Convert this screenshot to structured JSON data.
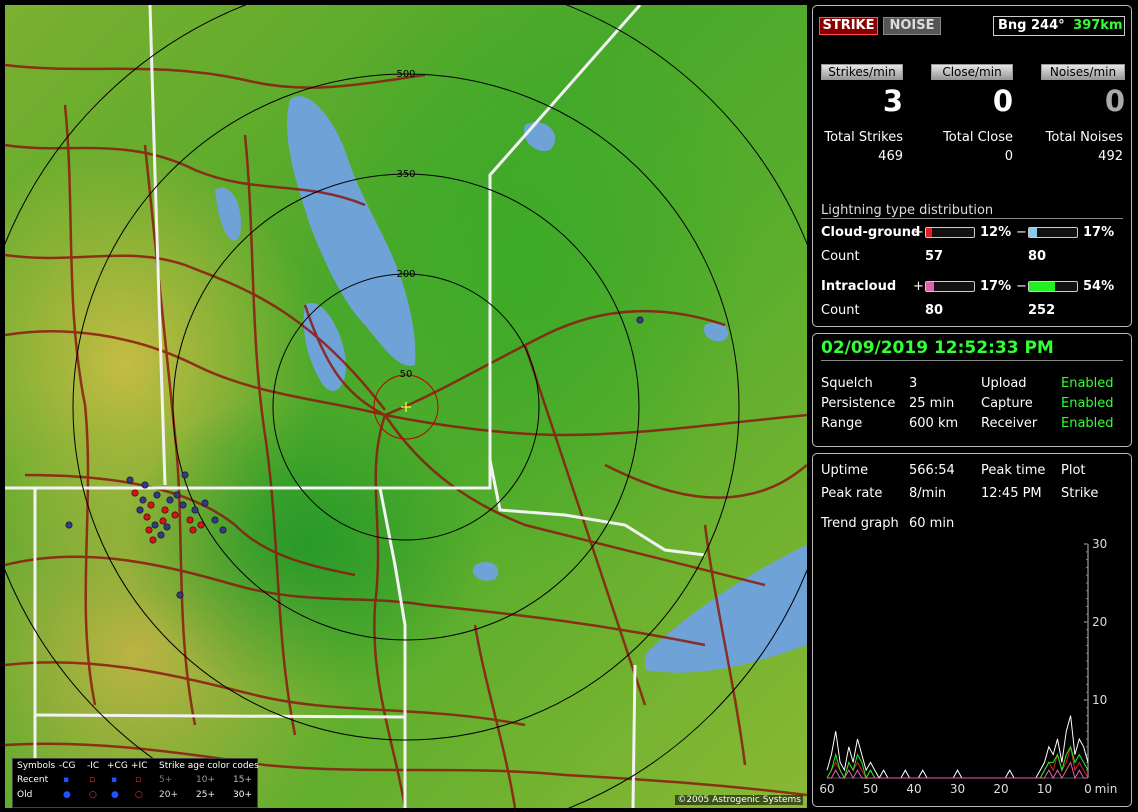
{
  "map": {
    "range_labels": [
      "50",
      "200",
      "350",
      "500"
    ],
    "legend": {
      "symbols_label": "Symbols",
      "col_headers": [
        "-CG",
        "-IC",
        "+CG",
        "+IC"
      ],
      "age_header": "Strike age color codes",
      "row_recent": "Recent",
      "row_old": "Old",
      "age_codes_row1": [
        "5+",
        "10+",
        "15+"
      ],
      "age_codes_row2": [
        "20+",
        "25+",
        "30+"
      ]
    },
    "copyright": "©2005 Astrogenic Systems"
  },
  "status": {
    "strike_label": "STRIKE",
    "noise_label": "NOISE",
    "bearing_label": "Bng 244°",
    "distance": "397km"
  },
  "rates": {
    "strikes_label": "Strikes/min",
    "close_label": "Close/min",
    "noises_label": "Noises/min",
    "strikes_value": "3",
    "close_value": "0",
    "noises_value": "0"
  },
  "totals": {
    "strikes_label": "Total Strikes",
    "close_label": "Total Close",
    "noises_label": "Total Noises",
    "strikes_value": "469",
    "close_value": "0",
    "noises_value": "492"
  },
  "distribution": {
    "title": "Lightning type distribution",
    "cg_label": "Cloud-ground",
    "ic_label": "Intracloud",
    "count_label": "Count",
    "plus": "+",
    "minus": "−",
    "cg_pos_pct": "12%",
    "cg_neg_pct": "17%",
    "ic_pos_pct": "17%",
    "ic_neg_pct": "54%",
    "cg_pos_frac": 0.12,
    "cg_neg_frac": 0.17,
    "ic_pos_frac": 0.17,
    "ic_neg_frac": 0.54,
    "cg_pos_count": "57",
    "cg_neg_count": "80",
    "ic_pos_count": "80",
    "ic_neg_count": "252",
    "colors": {
      "cg_pos": "#e02020",
      "cg_neg": "#8ec8f0",
      "ic_pos": "#e060b0",
      "ic_neg": "#22ee22"
    }
  },
  "settings": {
    "datetime": "02/09/2019 12:52:33 PM",
    "squelch_label": "Squelch",
    "squelch_value": "3",
    "persistence_label": "Persistence",
    "persistence_value": "25 min",
    "range_label": "Range",
    "range_value": "600 km",
    "upload_label": "Upload",
    "upload_value": "Enabled",
    "capture_label": "Capture",
    "capture_value": "Enabled",
    "receiver_label": "Receiver",
    "receiver_value": "Enabled"
  },
  "stats": {
    "uptime_label": "Uptime",
    "uptime_value": "566:54",
    "peak_time_label": "Peak time",
    "peak_time_value": "12:45 PM",
    "plot_label": "Plot",
    "plot_value": "Strike",
    "peak_rate_label": "Peak rate",
    "peak_rate_value": "8/min",
    "trend_label": "Trend graph",
    "trend_value": "60 min"
  },
  "chart_data": {
    "type": "line",
    "x_ticks": [
      "60",
      "50",
      "40",
      "30",
      "20",
      "10",
      "0"
    ],
    "x_unit": "min",
    "y_ticks": [
      "10",
      "20",
      "30"
    ],
    "ylim": [
      0,
      30
    ],
    "xlim": [
      60,
      0
    ],
    "series": [
      {
        "color": "#ffffff",
        "values": [
          1,
          3,
          6,
          2,
          1,
          4,
          2,
          5,
          3,
          1,
          2,
          1,
          0,
          1,
          0,
          0,
          0,
          0,
          1,
          0,
          0,
          0,
          1,
          0,
          0,
          0,
          0,
          0,
          0,
          0,
          1,
          0,
          0,
          0,
          0,
          0,
          0,
          0,
          0,
          0,
          0,
          0,
          1,
          0,
          0,
          0,
          0,
          0,
          0,
          1,
          2,
          4,
          3,
          5,
          2,
          6,
          8,
          3,
          5,
          4,
          2
        ]
      },
      {
        "color": "#e02020",
        "values": [
          0,
          1,
          2,
          1,
          0,
          2,
          1,
          2,
          1,
          0,
          1,
          0,
          0,
          0,
          0,
          0,
          0,
          0,
          0,
          0,
          0,
          0,
          0,
          0,
          0,
          0,
          0,
          0,
          0,
          0,
          0,
          0,
          0,
          0,
          0,
          0,
          0,
          0,
          0,
          0,
          0,
          0,
          0,
          0,
          0,
          0,
          0,
          0,
          0,
          0,
          1,
          2,
          1,
          3,
          1,
          2,
          4,
          1,
          2,
          1,
          0
        ]
      },
      {
        "color": "#22ee22",
        "values": [
          0,
          1,
          3,
          1,
          0,
          2,
          1,
          3,
          2,
          0,
          1,
          0,
          0,
          0,
          0,
          0,
          0,
          0,
          0,
          0,
          0,
          0,
          0,
          0,
          0,
          0,
          0,
          0,
          0,
          0,
          0,
          0,
          0,
          0,
          0,
          0,
          0,
          0,
          0,
          0,
          0,
          0,
          0,
          0,
          0,
          0,
          0,
          0,
          0,
          0,
          1,
          2,
          2,
          3,
          1,
          3,
          4,
          2,
          3,
          2,
          1
        ]
      },
      {
        "color": "#e060b0",
        "values": [
          0,
          0,
          1,
          0,
          0,
          1,
          0,
          1,
          0,
          0,
          0,
          0,
          0,
          0,
          0,
          0,
          0,
          0,
          0,
          0,
          0,
          0,
          0,
          0,
          0,
          0,
          0,
          0,
          0,
          0,
          0,
          0,
          0,
          0,
          0,
          0,
          0,
          0,
          0,
          0,
          0,
          0,
          0,
          0,
          0,
          0,
          0,
          0,
          0,
          0,
          0,
          1,
          0,
          1,
          0,
          1,
          2,
          0,
          1,
          0,
          0
        ]
      }
    ]
  }
}
